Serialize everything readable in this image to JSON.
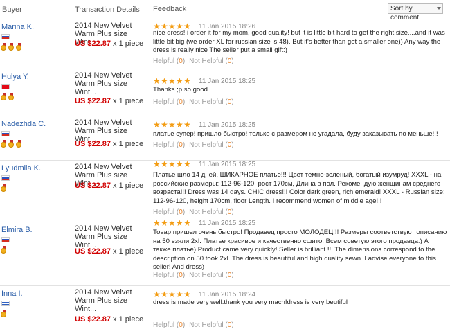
{
  "header": {
    "buyer": "Buyer",
    "transaction": "Transaction Details",
    "feedback": "Feedback",
    "sort": "Sort by comment"
  },
  "colors": {
    "buyer_link": "#2b5ea8",
    "price": "#d10000",
    "stars": "#f39c12",
    "count": "#e67e22"
  },
  "helpful_label": "Helpful",
  "not_helpful_label": "Not Helpful",
  "reviews": [
    {
      "buyer": "Marina K.",
      "country": "ru",
      "medals": 3,
      "product": "2014 New Velvet Warm Plus size Wint...",
      "price": "US $22.87",
      "qty": "x 1 piece",
      "rating": 5,
      "date": "11 Jan 2015 18:26",
      "text": "nice dress! i order it for my mom, good quality! but it is little bit hard to get the right size....and it was little bit big (we order XL for russian size is 48). But it's better than get a smaller one)) Any way the dress is really nice The seller put a small gift:)",
      "helpful": "0",
      "not_helpful": "0"
    },
    {
      "buyer": "Hulya Y.",
      "country": "tr",
      "medals": 2,
      "product": "2014 New Velvet Warm Plus size Wint...",
      "price": "US $22.87",
      "qty": "x 1 piece",
      "rating": 5,
      "date": "11 Jan 2015 18:25",
      "text": "Thanks ;p so good",
      "helpful": "0",
      "not_helpful": "0"
    },
    {
      "buyer": "Nadezhda C.",
      "country": "ru",
      "medals": 3,
      "product": "2014 New Velvet Warm Plus size Wint...",
      "price": "US $22.87",
      "qty": "x 1 piece",
      "rating": 5,
      "date": "11 Jan 2015 18:25",
      "text": "платье супер! пришло быстро! только с размером не угадала, буду заказывать по меньше!!!",
      "helpful": "0",
      "not_helpful": "0"
    },
    {
      "buyer": "Lyudmila K.",
      "country": "ru",
      "medals": 1,
      "product": "2014 New Velvet Warm Plus size Wint...",
      "price": "US $22.87",
      "qty": "x 1 piece",
      "rating": 5,
      "date": "11 Jan 2015 18:25",
      "text": "Платье шло 14 дней. ШИКАРНОЕ платье!!! Цвет темно-зеленый, богатый изумруд! XXXL - на российские размеры: 112-96-120, рост 170см, Длина в пол. Рекомендую женщинам среднего возраста!!! Dress was 14 days. CHIC dress!!! Color dark green, rich emerald! XXXL - Russian size: 112-96-120, height 170cm, floor Length. I recommend women of middle age!!!",
      "helpful": "0",
      "not_helpful": "0"
    },
    {
      "buyer": "Elmira B.",
      "country": "ru",
      "medals": 1,
      "product": "2014 New Velvet Warm Plus size Wint...",
      "price": "US $22.87",
      "qty": "x 1 piece",
      "rating": 5,
      "date": "11 Jan 2015 18:25",
      "text": "Товар пришел очень быстро! Продавец просто МОЛОДЕЦ!!! Размеры соответствуют описанию на 50 взяли 2xl. Платье красивое и качественно сшито. Всем советую этого продавца:) А также платье) Product came very quickly! Seller is brilliant !!! The dimensions correspond to the description on 50 took 2xl. The dress is beautiful and high quality sewn. I advise everyone to this seller! And dress)",
      "helpful": "0",
      "not_helpful": "0"
    },
    {
      "buyer": "Inna I.",
      "country": "il",
      "medals": 1,
      "product": "2014 New Velvet Warm Plus size Wint...",
      "price": "US $22.87",
      "qty": "x 1 piece",
      "rating": 5,
      "date": "11 Jan 2015 18:24",
      "text": "dress is made very well.thank you very mach!dress is very beutiful",
      "helpful": "0",
      "not_helpful": "0"
    }
  ]
}
